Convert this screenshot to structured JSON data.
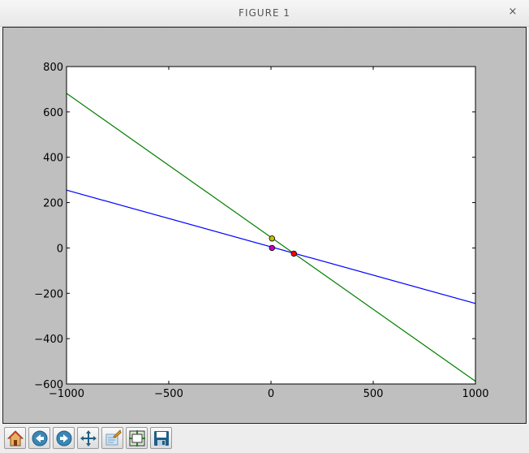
{
  "window": {
    "title": "FIGURE 1",
    "close_glyph": "×"
  },
  "toolbar": {
    "buttons": [
      {
        "name": "home-icon"
      },
      {
        "name": "back-icon"
      },
      {
        "name": "forward-icon"
      },
      {
        "name": "pan-icon"
      },
      {
        "name": "zoom-icon"
      },
      {
        "name": "subplots-icon"
      },
      {
        "name": "save-icon"
      }
    ]
  },
  "chart_data": {
    "type": "line",
    "xlim": [
      -1000,
      1000
    ],
    "ylim": [
      -600,
      800
    ],
    "xticks": [
      -1000,
      -500,
      0,
      500,
      1000
    ],
    "xtick_labels": [
      "−1000",
      "−500",
      "0",
      "500",
      "1000"
    ],
    "yticks": [
      -600,
      -400,
      -200,
      0,
      200,
      400,
      600,
      800
    ],
    "ytick_labels": [
      "−600",
      "−400",
      "−200",
      "0",
      "200",
      "400",
      "600",
      "800"
    ],
    "grid": false,
    "series": [
      {
        "color": "#0000ff",
        "x": [
          -1000,
          1000
        ],
        "y": [
          255,
          -245
        ]
      },
      {
        "color": "#008000",
        "x": [
          -1000,
          1000
        ],
        "y": [
          682,
          -588
        ]
      }
    ],
    "points": [
      {
        "x": 5,
        "y": 0,
        "color": "#bf00bf"
      },
      {
        "x": 5,
        "y": 42,
        "color": "#bfbf00"
      },
      {
        "x": 112,
        "y": -25,
        "color": "#ff0000"
      }
    ]
  }
}
